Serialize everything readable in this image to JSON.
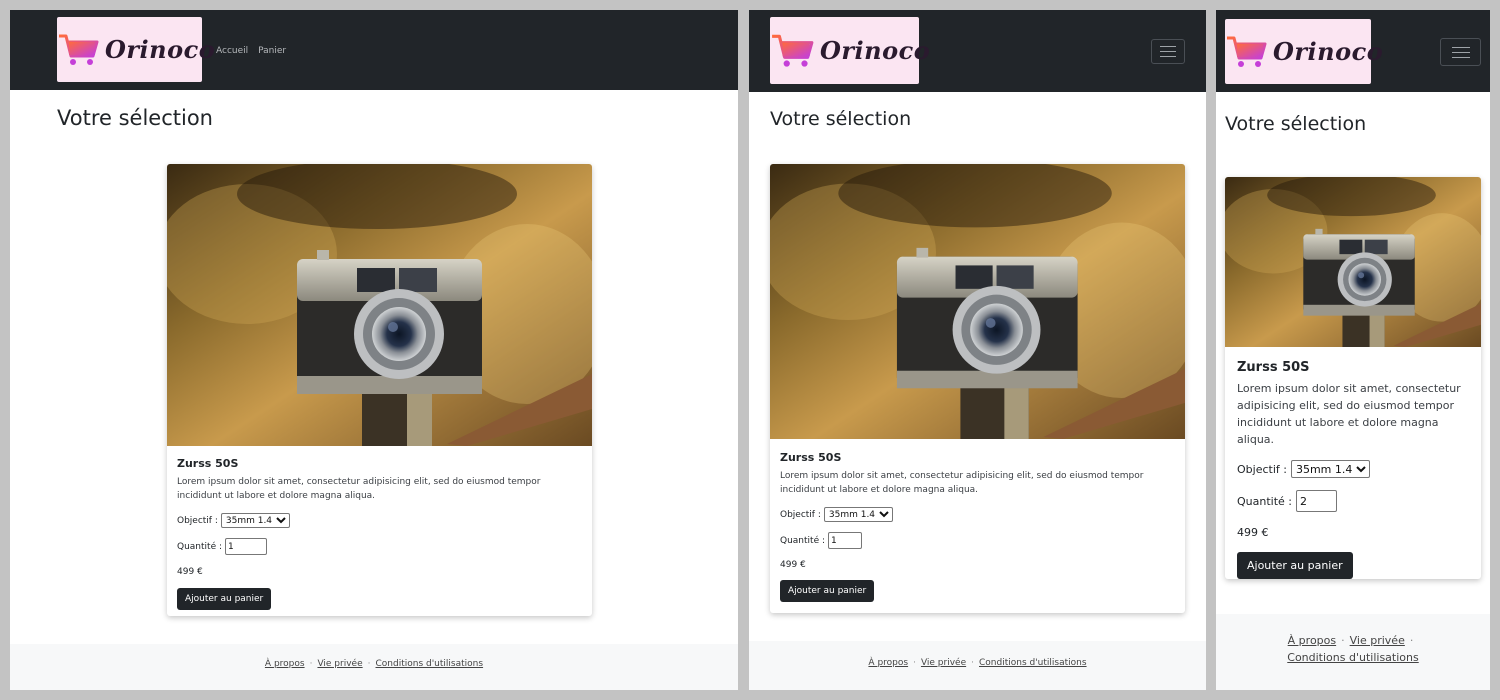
{
  "app": {
    "brand": "Orinoco",
    "nav": {
      "home": "Accueil",
      "cart": "Panier"
    },
    "page_title": "Votre sélection",
    "colors": {
      "navbar": "#212529",
      "logo_bg": "#fbe5f2",
      "button": "#212529",
      "footer": "#f7f8f9"
    },
    "icons": {
      "logo": "shopping-cart-icon",
      "menu": "hamburger-menu-icon"
    }
  },
  "frames": [
    {
      "product": {
        "name": "Zurss 50S",
        "description": "Lorem ipsum dolor sit amet, consectetur adipisicing elit, sed do eiusmod tempor incididunt ut labore et dolore magna aliqua.",
        "lens_label": "Objectif :",
        "lens_value": "35mm 1.4",
        "qty_label": "Quantité :",
        "qty_value": "1",
        "price": "499 €",
        "add_button": "Ajouter au panier"
      }
    },
    {
      "product": {
        "name": "Zurss 50S",
        "description": "Lorem ipsum dolor sit amet, consectetur adipisicing elit, sed do eiusmod tempor incididunt ut labore et dolore magna aliqua.",
        "lens_label": "Objectif :",
        "lens_value": "35mm 1.4",
        "qty_label": "Quantité :",
        "qty_value": "1",
        "price": "499 €",
        "add_button": "Ajouter au panier"
      }
    },
    {
      "product": {
        "name": "Zurss 50S",
        "description": "Lorem ipsum dolor sit amet, consectetur adipisicing elit, sed do eiusmod tempor incididunt ut labore et dolore magna aliqua.",
        "lens_label": "Objectif :",
        "lens_value": "35mm 1.4",
        "qty_label": "Quantité :",
        "qty_value": "2",
        "price": "499 €",
        "add_button": "Ajouter au panier"
      }
    }
  ],
  "footer": {
    "about": "À propos",
    "privacy": "Vie privée",
    "terms": "Conditions d'utilisations",
    "separator": "·"
  }
}
